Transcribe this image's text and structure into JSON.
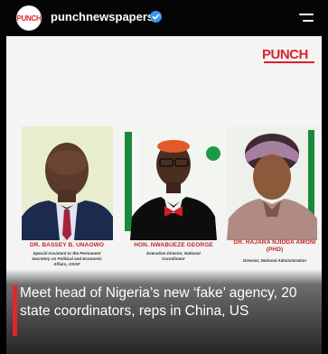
{
  "header": {
    "username": "punchnewspapers",
    "avatar_text": "PUNCH",
    "verified_icon": "verified-badge-icon",
    "menu_icon": "hamburger-menu-icon"
  },
  "post": {
    "brand_logo": "PUNCH",
    "people": [
      {
        "name": "DR. BASSEY B. UNAOWO",
        "role": "Special Assistant to the Permanent Secretary on Political and Economic Affairs, OSGF"
      },
      {
        "name": "HON. NWABUEZE GEORGE",
        "role": "Executive Director, National Coordinator"
      },
      {
        "name": "DR. HAJARA NJIDDA AMONI (PHD)",
        "role": "Director, National Administration"
      }
    ],
    "headline": "Meet head of Nigeria’s new ‘fake’ agency, 20 state coordinators, reps in China, US"
  },
  "colors": {
    "brand_red": "#d8232a",
    "caption_red": "#c52424",
    "headline_bar": "#e2262a",
    "verified_blue": "#3897f0"
  }
}
